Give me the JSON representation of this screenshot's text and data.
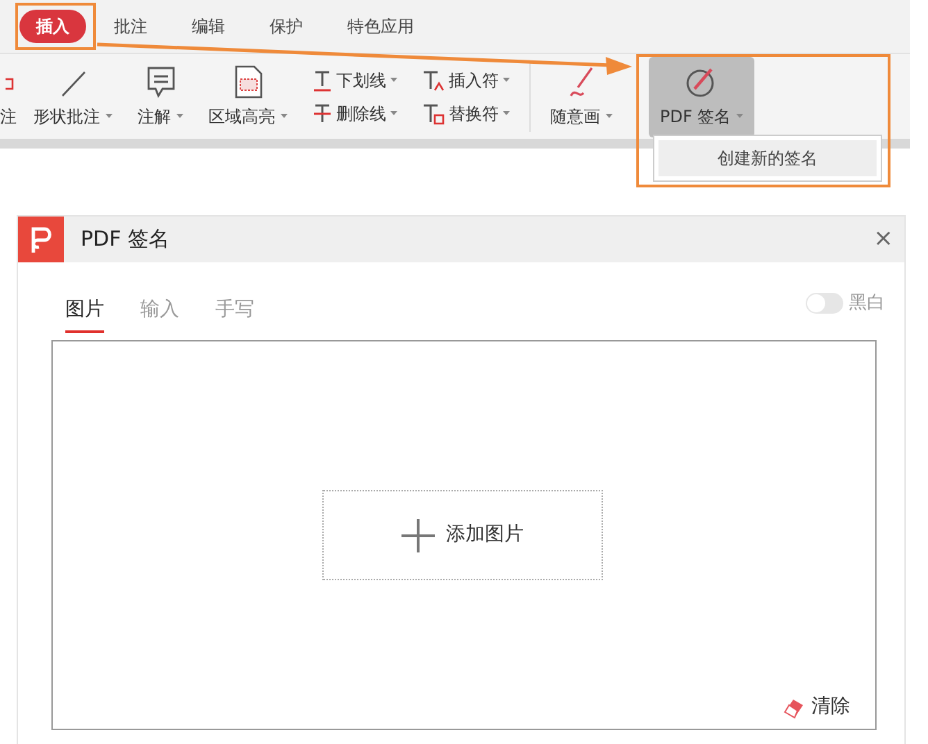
{
  "ribbon": {
    "tabs": [
      {
        "label": "插入",
        "selected": true
      },
      {
        "label": "批注",
        "selected": false
      },
      {
        "label": "编辑",
        "selected": false
      },
      {
        "label": "保护",
        "selected": false
      },
      {
        "label": "特色应用",
        "selected": false
      }
    ],
    "tools": [
      {
        "kind": "large",
        "label": "注",
        "dropdown": false,
        "selected": false
      },
      {
        "kind": "large",
        "label": "形状批注",
        "dropdown": true,
        "selected": false
      },
      {
        "kind": "large",
        "label": "注解",
        "dropdown": true,
        "selected": false
      },
      {
        "kind": "large",
        "label": "区域高亮",
        "dropdown": true,
        "selected": false
      },
      {
        "kind": "pair",
        "items": [
          {
            "label": "下划线",
            "dropdown": true
          },
          {
            "label": "删除线",
            "dropdown": true
          }
        ]
      },
      {
        "kind": "pair",
        "items": [
          {
            "label": "插入符",
            "dropdown": true
          },
          {
            "label": "替换符",
            "dropdown": true
          }
        ]
      },
      {
        "kind": "large",
        "label": "随意画",
        "dropdown": true,
        "selected": false
      },
      {
        "kind": "large",
        "label": "PDF 签名",
        "dropdown": true,
        "selected": true
      }
    ],
    "menu": {
      "items": [
        "创建新的签名"
      ]
    }
  },
  "dialog": {
    "title": "PDF 签名",
    "close": "×",
    "tabs": [
      {
        "label": "图片",
        "selected": true
      },
      {
        "label": "输入",
        "selected": false
      },
      {
        "label": "手写",
        "selected": false
      }
    ],
    "toggle": {
      "label": "黑白",
      "on": false
    },
    "add_button": {
      "label": "添加图片"
    },
    "clear_button": {
      "label": "清除"
    }
  }
}
